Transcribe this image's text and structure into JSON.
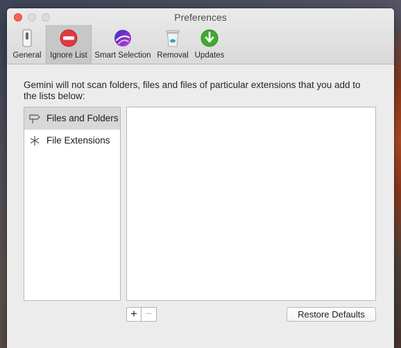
{
  "window": {
    "title": "Preferences"
  },
  "toolbar": {
    "tabs": [
      {
        "label": "General",
        "icon": "switch-icon"
      },
      {
        "label": "Ignore List",
        "icon": "no-entry-icon",
        "selected": true
      },
      {
        "label": "Smart Selection",
        "icon": "smart-selection-icon"
      },
      {
        "label": "Removal",
        "icon": "trash-icon"
      },
      {
        "label": "Updates",
        "icon": "download-arrow-icon"
      }
    ]
  },
  "main": {
    "description": "Gemini will not scan folders, files and files of particular extensions that you add to the lists below:",
    "sidebar": {
      "items": [
        {
          "label": "Files and Folders",
          "icon": "signpost-icon",
          "selected": true
        },
        {
          "label": "File Extensions",
          "icon": "asterisk-icon",
          "selected": false
        }
      ]
    },
    "buttons": {
      "add": "+",
      "remove": "−",
      "restore_defaults": "Restore Defaults"
    }
  },
  "colors": {
    "close_button": "#fc5f57",
    "no_entry_red": "#e0393e",
    "updates_green": "#43a833",
    "selected_tab_bg": "#c7c7c7",
    "selected_row_bg": "#d8d8d8"
  }
}
